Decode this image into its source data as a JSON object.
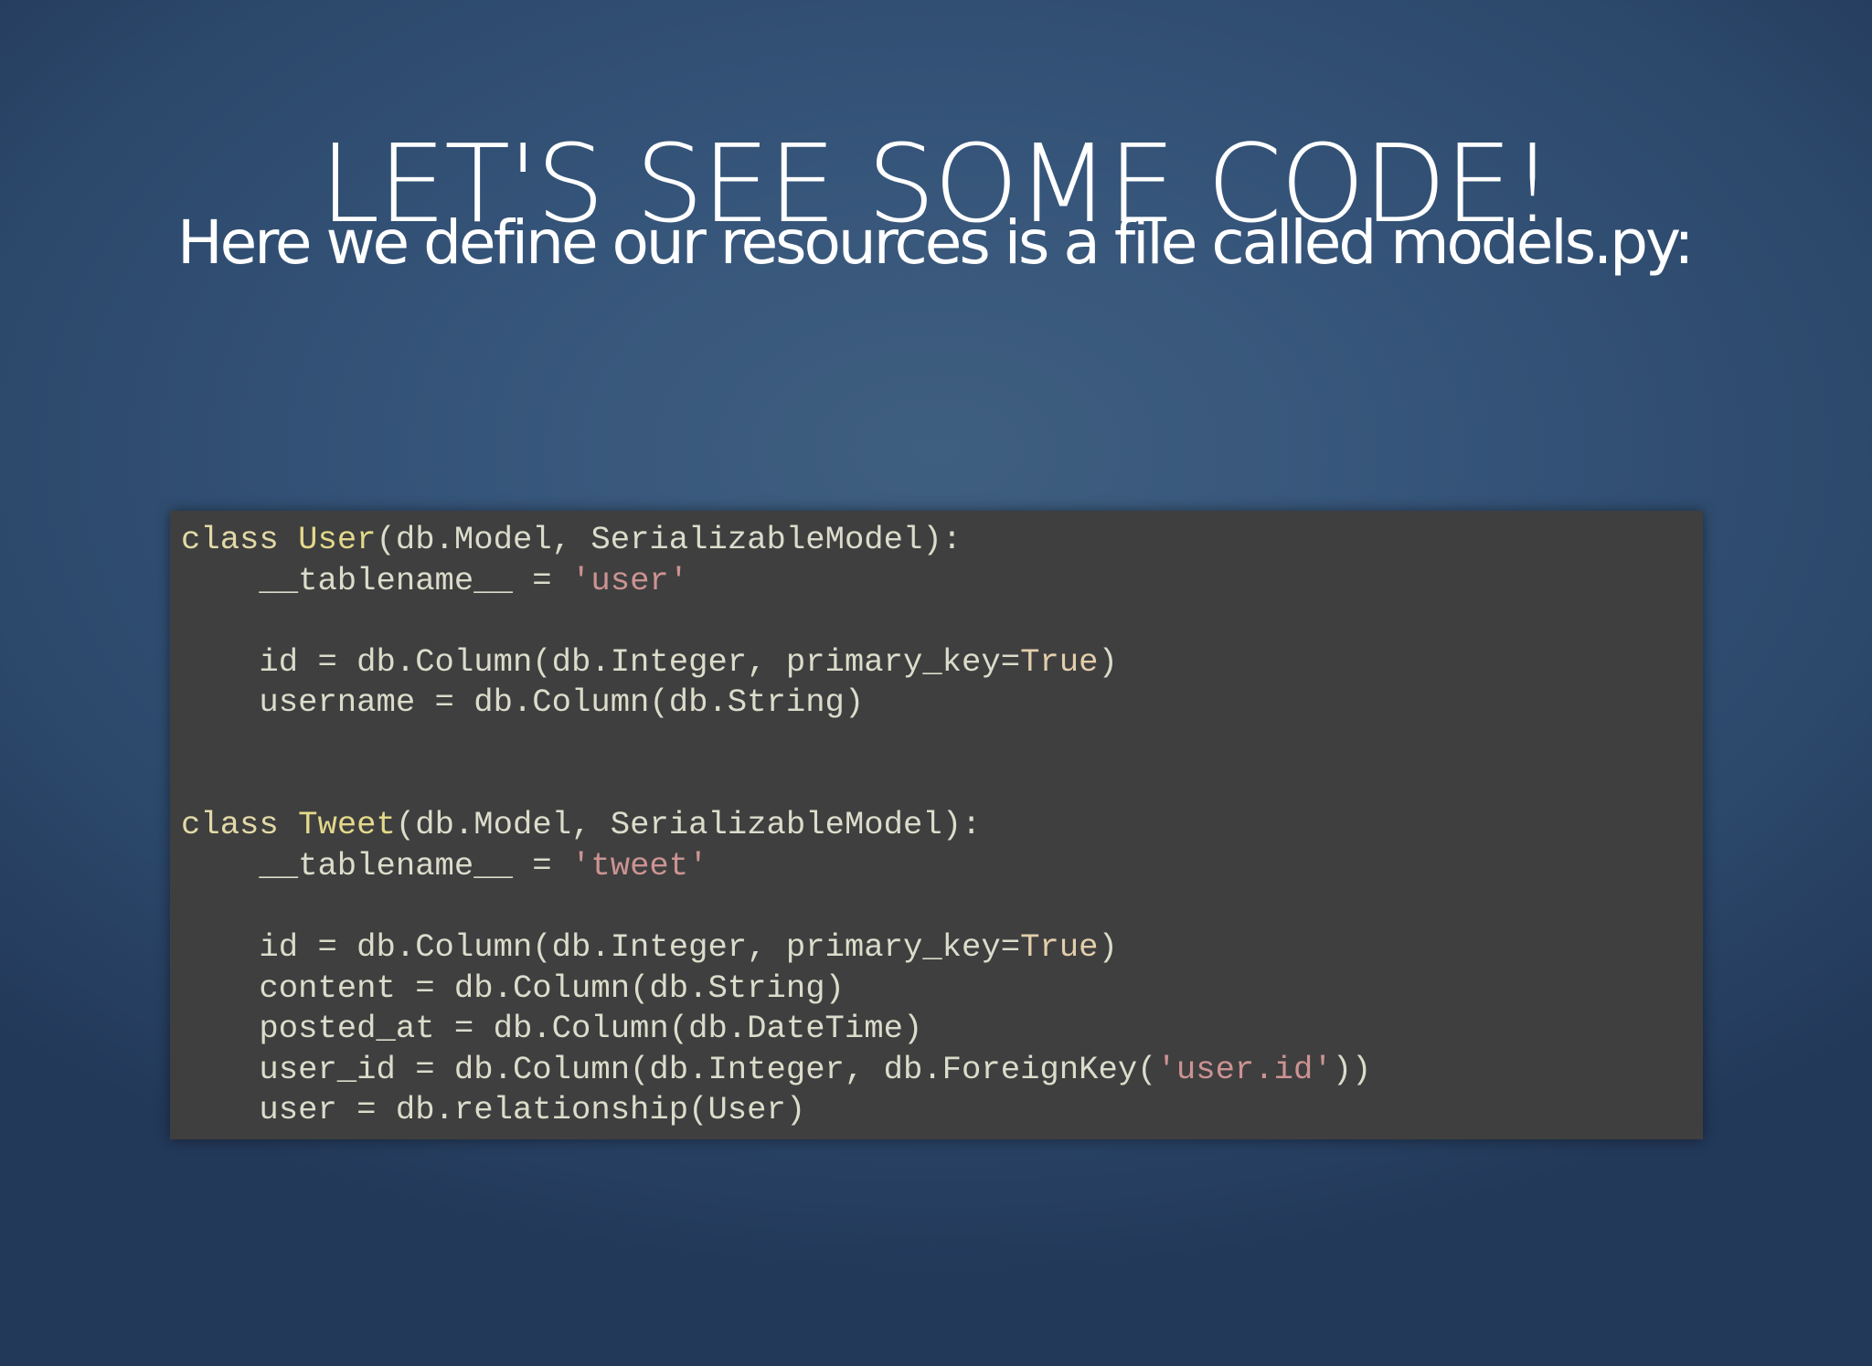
{
  "slide": {
    "title": "LET'S SEE SOME CODE!",
    "subtitle": "Here we define our resources is a file called  models.py:"
  },
  "colors": {
    "background": "#36557a",
    "code_background": "#3f3f3f",
    "code_text": "#dcdccc",
    "keyword": "#e2d9a6",
    "class_name": "#e3d98a",
    "string": "#cc9393",
    "boolean": "#e3ceab",
    "title_text": "#ffffff"
  },
  "code": {
    "language": "python",
    "lines": [
      [
        {
          "t": "class",
          "k": "keyword"
        },
        {
          "t": " ",
          "k": "plain"
        },
        {
          "t": "User",
          "k": "classname"
        },
        {
          "t": "(db.Model, SerializableModel):",
          "k": "plain"
        }
      ],
      [
        {
          "t": "    __tablename__ = ",
          "k": "plain"
        },
        {
          "t": "'user'",
          "k": "string"
        }
      ],
      [],
      [
        {
          "t": "    id = db.Column(db.Integer, primary_key=",
          "k": "plain"
        },
        {
          "t": "True",
          "k": "bool"
        },
        {
          "t": ")",
          "k": "plain"
        }
      ],
      [
        {
          "t": "    username = db.Column(db.String)",
          "k": "plain"
        }
      ],
      [],
      [],
      [
        {
          "t": "class",
          "k": "keyword"
        },
        {
          "t": " ",
          "k": "plain"
        },
        {
          "t": "Tweet",
          "k": "classname"
        },
        {
          "t": "(db.Model, SerializableModel):",
          "k": "plain"
        }
      ],
      [
        {
          "t": "    __tablename__ = ",
          "k": "plain"
        },
        {
          "t": "'tweet'",
          "k": "string"
        }
      ],
      [],
      [
        {
          "t": "    id = db.Column(db.Integer, primary_key=",
          "k": "plain"
        },
        {
          "t": "True",
          "k": "bool"
        },
        {
          "t": ")",
          "k": "plain"
        }
      ],
      [
        {
          "t": "    content = db.Column(db.String)",
          "k": "plain"
        }
      ],
      [
        {
          "t": "    posted_at = db.Column(db.DateTime)",
          "k": "plain"
        }
      ],
      [
        {
          "t": "    user_id = db.Column(db.Integer, db.ForeignKey(",
          "k": "plain"
        },
        {
          "t": "'user.id'",
          "k": "string"
        },
        {
          "t": "))",
          "k": "plain"
        }
      ],
      [
        {
          "t": "    user = db.relationship(User)",
          "k": "plain"
        }
      ]
    ]
  }
}
